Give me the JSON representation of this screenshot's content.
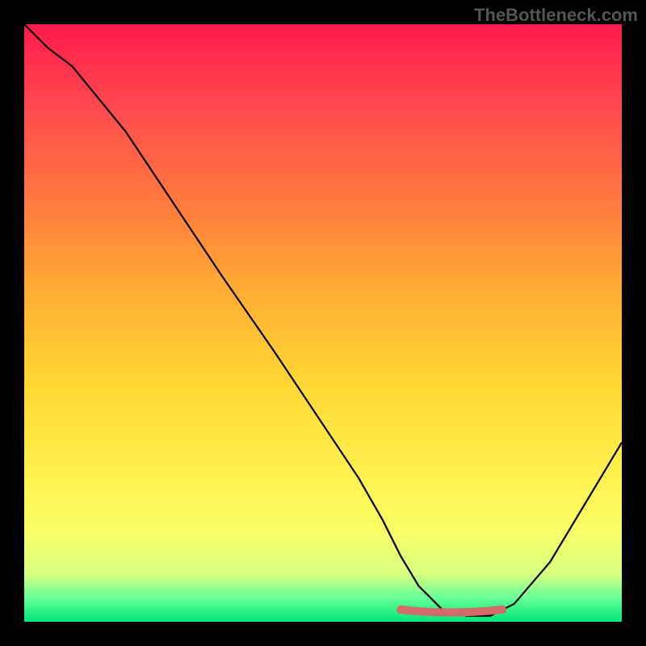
{
  "watermark": "TheBottleneck.com",
  "chart_data": {
    "type": "line",
    "title": "",
    "xlabel": "",
    "ylabel": "",
    "xlim": [
      0,
      100
    ],
    "ylim": [
      0,
      100
    ],
    "grid": false,
    "legend": false,
    "series": [
      {
        "name": "curve",
        "x": [
          0,
          4,
          8,
          17,
          25,
          33,
          42,
          50,
          56,
          60,
          63,
          66,
          70,
          74,
          78,
          82,
          88,
          100
        ],
        "values": [
          100,
          96,
          93,
          82,
          70,
          58,
          45,
          33,
          24,
          17,
          11,
          6,
          2,
          1,
          1,
          3,
          10,
          30
        ]
      }
    ],
    "optimal_band": {
      "x_start": 63,
      "x_end": 80,
      "y": 1.5
    },
    "colors": {
      "gradient_top": "#ff1a4d",
      "gradient_mid": "#fff04d",
      "gradient_bottom": "#00e676",
      "curve": "#000000",
      "marker": "#d46a6a",
      "background": "#000000"
    }
  }
}
